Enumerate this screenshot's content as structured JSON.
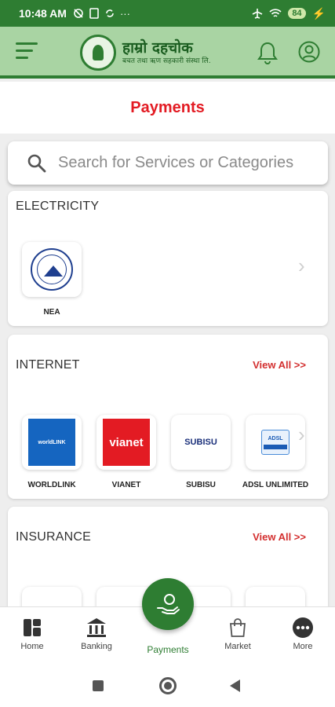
{
  "status_bar": {
    "time": "10:48 AM",
    "battery": "84"
  },
  "header": {
    "logo_title": "हाम्रो दहचोक",
    "logo_subtitle": "बचत तथा ऋण सहकारी संस्था लि."
  },
  "page_title": "Payments",
  "search": {
    "placeholder": "Search for Services or Categories"
  },
  "sections": [
    {
      "title": "ELECTRICITY",
      "items": [
        {
          "label": "NEA",
          "icon": "nea-logo"
        }
      ]
    },
    {
      "title": "INTERNET",
      "view_all": "View All >>",
      "items": [
        {
          "label": "WORLDLINK",
          "icon": "worldlink-logo",
          "logo_text": "worldLINK"
        },
        {
          "label": "VIANET",
          "icon": "vianet-logo",
          "logo_text": "vianet"
        },
        {
          "label": "SUBISU",
          "icon": "subisu-logo",
          "logo_text": "SUBISU"
        },
        {
          "label": "ADSL UNLIMITED",
          "icon": "adsl-logo",
          "logo_text": "ADSL"
        }
      ]
    },
    {
      "title": "INSURANCE",
      "view_all": "View All >>"
    }
  ],
  "bottom_nav": [
    {
      "label": "Home",
      "icon": "home-icon"
    },
    {
      "label": "Banking",
      "icon": "bank-icon"
    },
    {
      "label": "Payments",
      "icon": "payments-hand-icon",
      "active": true
    },
    {
      "label": "Market",
      "icon": "shopping-bag-icon"
    },
    {
      "label": "More",
      "icon": "more-dots-icon"
    }
  ],
  "colors": {
    "primary_green": "#2e7d32",
    "header_green": "#a9d4a3",
    "accent_red": "#e31b23"
  }
}
